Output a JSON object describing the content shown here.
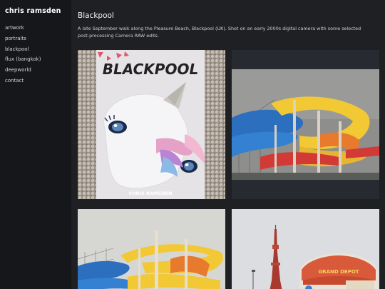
{
  "site": {
    "title": "chris ramsden"
  },
  "nav": {
    "items": [
      {
        "label": "artwork"
      },
      {
        "label": "portraits"
      },
      {
        "label": "blackpool"
      },
      {
        "label": "flux (bangkok)"
      },
      {
        "label": "deepworld"
      },
      {
        "label": "contact"
      }
    ]
  },
  "page": {
    "title": "Blackpool",
    "description": "A late September walk along the Pleasure Beach, Blackpool (UK). Shot on an early 2000s digital camera with some selected post-processing Camera RAW edits."
  },
  "gallery": {
    "book_cover_title": "BLACKPOOL",
    "book_cover_author": "CHRIS RAMSDEN",
    "sign_text": "GRAND DEPOT"
  },
  "colors": {
    "sidebar_bg": "#16171a",
    "page_bg": "#1e2024",
    "tile_bg": "#272a30"
  }
}
